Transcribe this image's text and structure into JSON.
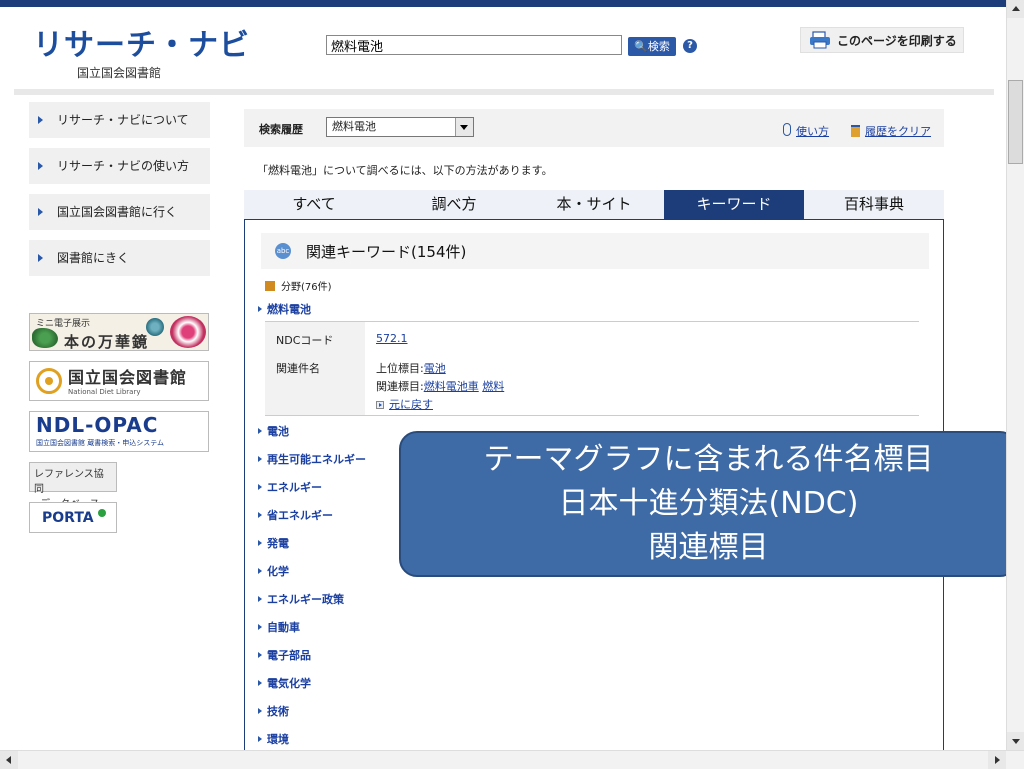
{
  "header": {
    "logo_title": "リサーチ・ナビ",
    "logo_subtitle": "国立国会図書館",
    "search_value": "燃料電池",
    "search_button": "検索",
    "help_glyph": "?",
    "print_label": "このページを印刷する"
  },
  "nav": {
    "items": [
      {
        "label": "リサーチ・ナビについて"
      },
      {
        "label": "リサーチ・ナビの使い方"
      },
      {
        "label": "国立国会図書館に行く"
      },
      {
        "label": "図書館にきく"
      }
    ]
  },
  "banners": {
    "mini_exhibit_top": "ミニ電子展示",
    "mini_exhibit_main": "本の万華鏡",
    "ndl_name": "国立国会図書館",
    "ndl_english": "National Diet Library",
    "opac_title": "NDL-OPAC",
    "opac_sub": "国立国会図書館 蔵書検索・申込システム",
    "reference_line1": "レファレンス協同",
    "reference_line2": "データベース",
    "porta": "PORTA"
  },
  "main": {
    "history_label": "検索履歴",
    "history_value": "燃料電池",
    "howto_link": "使い方",
    "clear_link": "履歴をクリア",
    "intro": "「燃料電池」について調べるには、以下の方法があります。",
    "tabs": [
      {
        "label": "すべて"
      },
      {
        "label": "調べ方"
      },
      {
        "label": "本・サイト"
      },
      {
        "label": "キーワード"
      },
      {
        "label": "百科事典"
      }
    ],
    "active_tab": "キーワード",
    "section_icon_text": "abc",
    "section_title": "関連キーワード(154件)",
    "field_line": "分野(76件)",
    "first_keyword": "燃料電池",
    "detail": {
      "ndc_label": "NDCコード",
      "ndc_value": "572.1",
      "related_label": "関連件名",
      "upper_prefix": "上位標目:",
      "upper_link": "電池",
      "related_prefix": "関連標目:",
      "related_link1": "燃料電池車",
      "related_link2": "燃料",
      "back_link": "元に戻す"
    },
    "keywords": [
      "電池",
      "再生可能エネルギー",
      "エネルギー",
      "省エネルギー",
      "発電",
      "化学",
      "エネルギー政策",
      "自動車",
      "電子部品",
      "電気化学",
      "技術",
      "環境"
    ]
  },
  "callout": {
    "line1": "テーマグラフに含まれる件名標目",
    "line2": "日本十進分類法(NDC)",
    "line3": "関連標目"
  },
  "colors": {
    "brand": "#1d4e9e",
    "navy": "#1d3d7a",
    "callout": "#3e6aa6"
  }
}
